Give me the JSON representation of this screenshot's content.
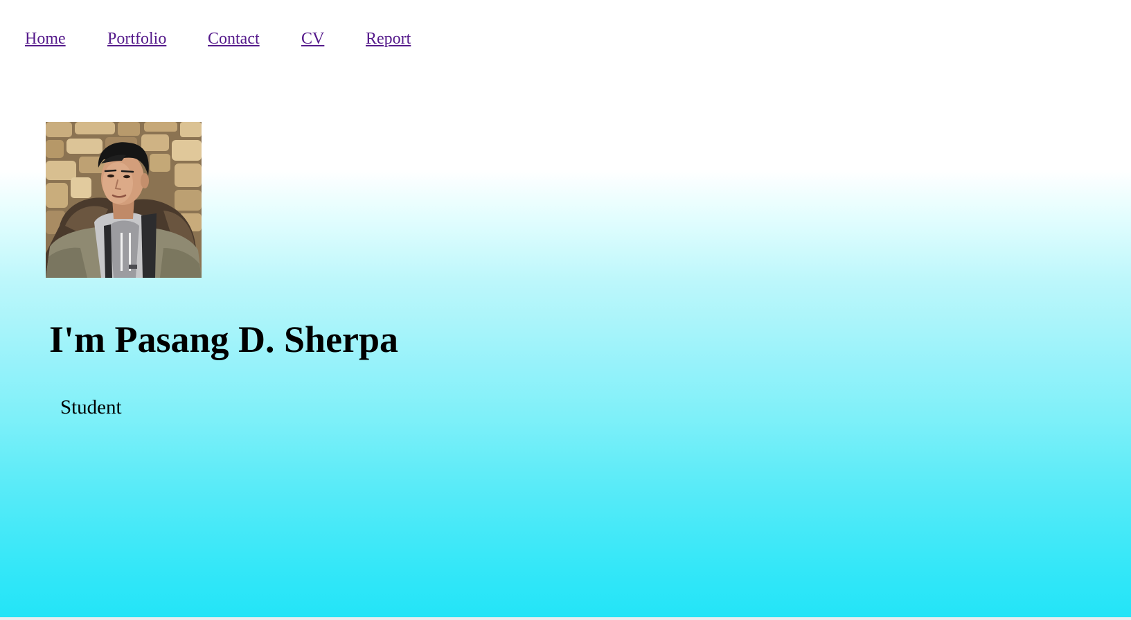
{
  "nav": {
    "items": [
      {
        "label": "Home"
      },
      {
        "label": "Portfolio"
      },
      {
        "label": "Contact"
      },
      {
        "label": "CV"
      },
      {
        "label": "Report"
      }
    ],
    "link_color": "#551a8b"
  },
  "hero": {
    "name": "I'm Pasang D. Sherpa",
    "role": "Student"
  },
  "colors": {
    "background_top": "#ffffff",
    "background_bottom": "#22e4f7",
    "text": "#000000"
  }
}
